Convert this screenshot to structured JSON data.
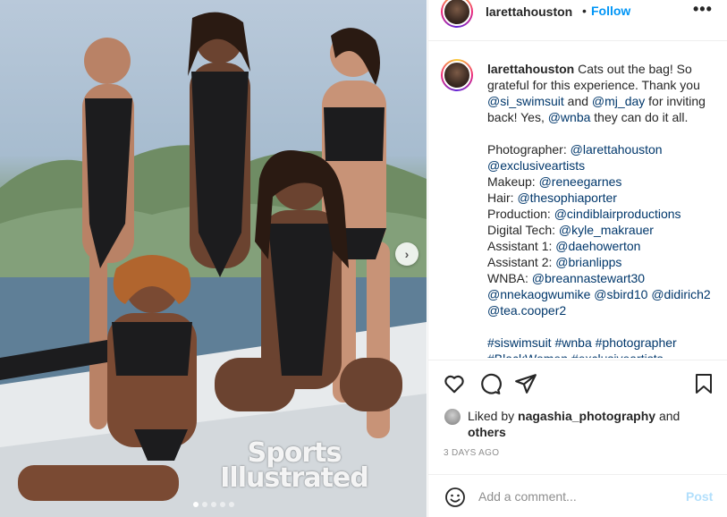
{
  "post": {
    "username": "larettahouston",
    "separator": "•",
    "follow_label": "Follow",
    "more_label": "•••",
    "photo_logo": [
      "Sports",
      "Illustrated"
    ],
    "carousel": {
      "total": 5,
      "active": 0
    }
  },
  "caption": {
    "username": "larettahouston",
    "lines": [
      [
        {
          "t": " Cats out the bag! So"
        }
      ],
      [
        {
          "t": "grateful for this experience. Thank you"
        }
      ],
      [
        {
          "m": "@si_swimsuit"
        },
        {
          "t": " and "
        },
        {
          "m": "@mj_day"
        },
        {
          "t": " for inviting"
        }
      ],
      [
        {
          "t": "back! Yes, "
        },
        {
          "m": "@wnba"
        },
        {
          "t": " they can do it all."
        }
      ],
      [],
      [
        {
          "t": "Photographer: "
        },
        {
          "m": "@larettahouston"
        }
      ],
      [
        {
          "m": "@exclusiveartists"
        }
      ],
      [
        {
          "t": "Makeup: "
        },
        {
          "m": "@reneegarnes"
        }
      ],
      [
        {
          "t": "Hair: "
        },
        {
          "m": "@thesophiaporter"
        }
      ],
      [
        {
          "t": "Production: "
        },
        {
          "m": "@cindiblairproductions"
        }
      ],
      [
        {
          "t": "Digital Tech: "
        },
        {
          "m": "@kyle_makrauer"
        }
      ],
      [
        {
          "t": "Assistant 1: "
        },
        {
          "m": "@daehowerton"
        }
      ],
      [
        {
          "t": "Assistant 2: "
        },
        {
          "m": "@brianlipps"
        }
      ],
      [
        {
          "t": "WNBA: "
        },
        {
          "m": "@breannastewart30"
        }
      ],
      [
        {
          "m": "@nnekaogwumike"
        },
        {
          "t": " "
        },
        {
          "m": "@sbird10"
        },
        {
          "t": " "
        },
        {
          "m": "@didirich2"
        }
      ],
      [
        {
          "m": "@tea.cooper2"
        }
      ],
      [],
      [
        {
          "m": "#siswimsuit"
        },
        {
          "t": " "
        },
        {
          "m": "#wnba"
        },
        {
          "t": " "
        },
        {
          "m": "#photographer"
        }
      ],
      [
        {
          "m": "#BlackWomen"
        },
        {
          "t": " "
        },
        {
          "m": "#exclusiveartists"
        }
      ]
    ]
  },
  "actions": {
    "icons": [
      "heart-icon",
      "comment-icon",
      "share-icon",
      "bookmark-icon"
    ]
  },
  "likes": {
    "liked_by_prefix": "Liked by ",
    "liked_by_user": "nagashia_photography",
    "and_label": " and",
    "others_label": "others"
  },
  "date": "3 DAYS AGO",
  "comment": {
    "placeholder": "Add a comment...",
    "post_label": "Post"
  },
  "colors": {
    "link": "#0095f6",
    "mention": "#00376b",
    "post_disabled": "#b2dffc",
    "muted": "#8e8e8e"
  }
}
